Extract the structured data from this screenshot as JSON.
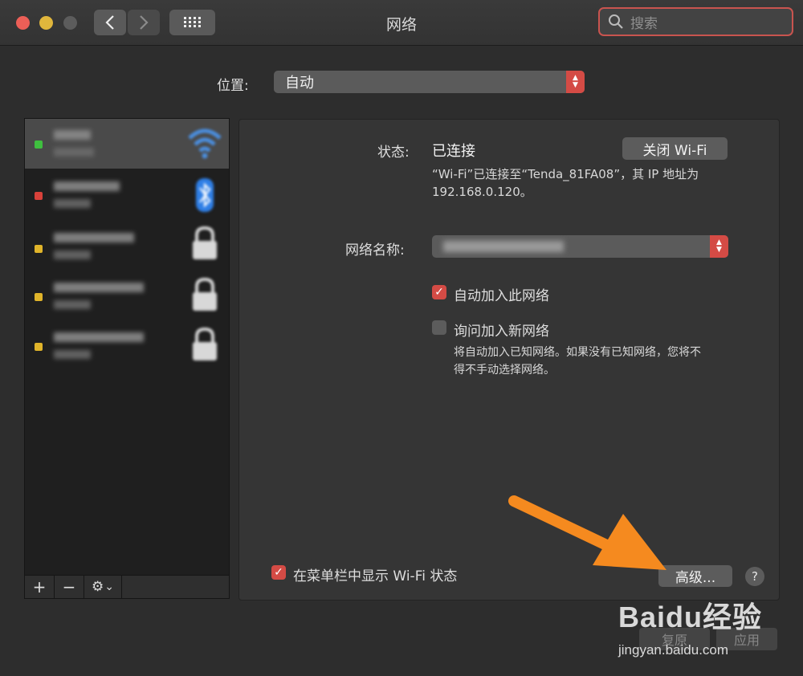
{
  "window": {
    "title": "网络"
  },
  "search": {
    "placeholder": "搜索"
  },
  "location": {
    "label": "位置:",
    "value": "自动"
  },
  "status": {
    "label": "状态:",
    "value": "已连接",
    "toggle_button": "关闭 Wi-Fi",
    "description_line1": "“Wi-Fi”已连接至“Tenda_81FA08”，其 IP 地址为",
    "description_line2": "192.168.0.120。"
  },
  "network_name": {
    "label": "网络名称:"
  },
  "options": {
    "auto_join": {
      "label": "自动加入此网络",
      "checked": true
    },
    "ask_join": {
      "label": "询问加入新网络",
      "checked": false
    },
    "ask_join_note_line1": "将自动加入已知网络。如果没有已知网络，您将不",
    "ask_join_note_line2": "得不手动选择网络。"
  },
  "menubar_status": {
    "label": "在菜单栏中显示 Wi-Fi 状态",
    "checked": true
  },
  "buttons": {
    "advanced": "高级...",
    "help": "?",
    "revert": "复原",
    "apply": "应用"
  },
  "sidebar_controls": {
    "add": "+",
    "remove": "−",
    "gear": "⚙",
    "chevron": "⌄"
  },
  "services": [
    {
      "status_color": "#3fbf3f",
      "icon": "wifi-icon"
    },
    {
      "status_color": "#d8413a",
      "icon": "bluetooth-icon"
    },
    {
      "status_color": "#e0b42a",
      "icon": "lock-icon"
    },
    {
      "status_color": "#e0b42a",
      "icon": "lock-icon"
    },
    {
      "status_color": "#e0b42a",
      "icon": "lock-icon"
    }
  ],
  "watermark": {
    "brand": "Baidu经验",
    "url": "jingyan.baidu.com"
  },
  "colors": {
    "accent": "#d44b45",
    "annotation_arrow": "#f58a1f"
  }
}
